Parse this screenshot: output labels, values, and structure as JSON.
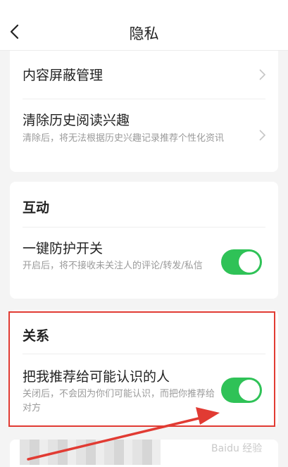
{
  "header": {
    "title": "隐私"
  },
  "content_card": {
    "blocked_content_label": "内容屏蔽管理",
    "clear_history_label": "清除历史阅读兴趣",
    "clear_history_desc": "清除后，将无法根据历史兴趣记录推荐个性化资讯"
  },
  "interaction_card": {
    "section_title": "互动",
    "protection_label": "一键防护开关",
    "protection_desc": "开启后，将不接收未关注人的评论/转发/私信",
    "protection_on": true
  },
  "relationship_card": {
    "section_title": "关系",
    "recommend_label": "把我推荐给可能认识的人",
    "recommend_desc": "关闭后，不会因为你们可能认识，而把你推荐给对方",
    "recommend_on": true
  },
  "watermark": {
    "text": "Baidu 经验"
  },
  "colors": {
    "toggle_on": "#2fc257",
    "highlight": "#e13b33"
  }
}
